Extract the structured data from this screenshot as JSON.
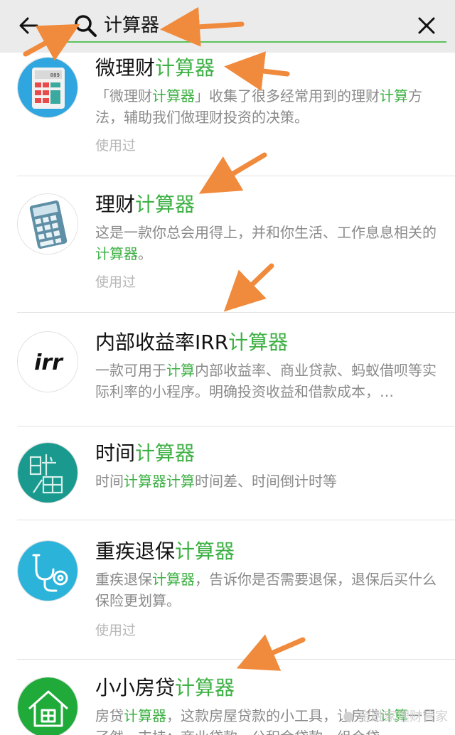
{
  "search": {
    "query": "计算器",
    "back_icon": "back-arrow-icon",
    "search_icon": "magnifier-icon",
    "clear_icon": "close-icon",
    "accent": "#5cc25a"
  },
  "results": [
    {
      "title_prefix": "微理财",
      "title_hl": "计算器",
      "desc_parts": [
        {
          "t": "「微理财",
          "hl": false
        },
        {
          "t": "计算器",
          "hl": true
        },
        {
          "t": "」收集了很多经常用到的理财",
          "hl": false
        },
        {
          "t": "计算",
          "hl": true
        },
        {
          "t": "方法，辅助我们做理财投资的决策。",
          "hl": false
        }
      ],
      "used": "使用过",
      "icon": "calculator-blue-icon"
    },
    {
      "title_prefix": "理财",
      "title_hl": "计算器",
      "desc_parts": [
        {
          "t": "这是一款你总会用得上，并和你生活、工作息息相关的",
          "hl": false
        },
        {
          "t": "计算器",
          "hl": true
        },
        {
          "t": "。",
          "hl": false
        }
      ],
      "used": "使用过",
      "icon": "calculator-gray-icon"
    },
    {
      "title_prefix": "内部收益率IRR",
      "title_hl": "计算器",
      "desc_parts": [
        {
          "t": "一款可用于",
          "hl": false
        },
        {
          "t": "计算",
          "hl": true
        },
        {
          "t": "内部收益率、商业贷款、蚂蚁借呗等实际利率的小程序。明确投资收益和借款成本，…",
          "hl": false
        }
      ],
      "used": "",
      "icon": "irr-logo-icon",
      "icon_text": "irr"
    },
    {
      "title_prefix": "时间",
      "title_hl": "计算器",
      "desc_parts": [
        {
          "t": "时间",
          "hl": false
        },
        {
          "t": "计算器计算",
          "hl": true
        },
        {
          "t": "时间差、时间倒计时等",
          "hl": false
        }
      ],
      "used": "",
      "icon": "time-logo-icon",
      "icon_text": "时间"
    },
    {
      "title_prefix": "重疾退保",
      "title_hl": "计算器",
      "desc_parts": [
        {
          "t": "重疾退保",
          "hl": false
        },
        {
          "t": "计算器",
          "hl": true
        },
        {
          "t": "，告诉你是否需要退保，退保后买什么保险更划算。",
          "hl": false
        }
      ],
      "used": "使用过",
      "icon": "stethoscope-icon"
    },
    {
      "title_prefix": "小小房贷",
      "title_hl": "计算器",
      "desc_parts": [
        {
          "t": "房贷",
          "hl": false
        },
        {
          "t": "计算器",
          "hl": true
        },
        {
          "t": "，这款房屋贷款的小工具，让房贷",
          "hl": false
        },
        {
          "t": "计算",
          "hl": true
        },
        {
          "t": "一目了然，支持：商业贷款、公积金贷款、组合贷",
          "hl": false
        }
      ],
      "used": "",
      "icon": "house-icon"
    }
  ],
  "watermark": "金融家理财管家",
  "annotation_color": "#f08a3c"
}
